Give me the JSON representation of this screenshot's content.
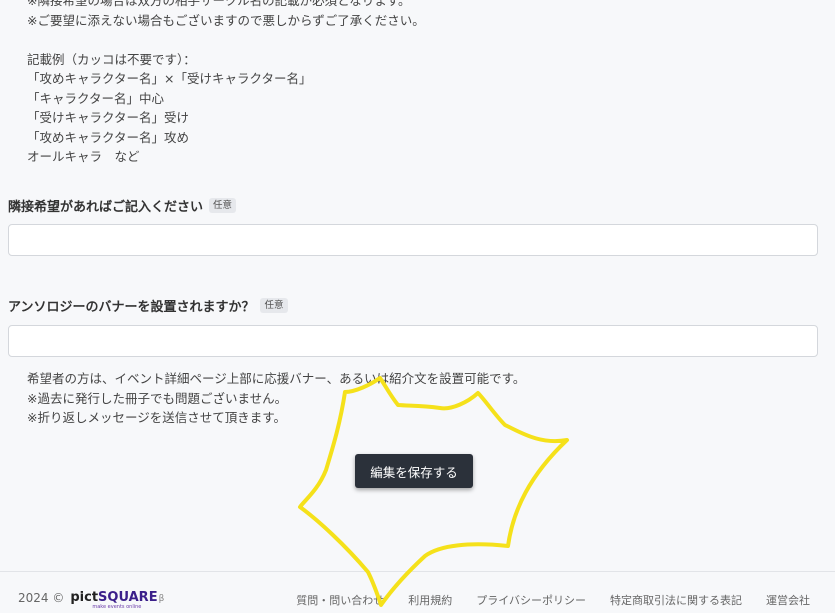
{
  "top_notes": [
    "※隣接希望の場合は双方の相手サークル名の記載が必須となります。",
    "※ご要望に添えない場合もございますので悪しからずご了承ください。",
    "",
    "記載例（カッコは不要です）：",
    "「攻めキャラクター名」×「受けキャラクター名」",
    "「キャラクター名」中心",
    "「受けキャラクター名」受け",
    "「攻めキャラクター名」攻め",
    "オールキャラ　など"
  ],
  "neighbor_field": {
    "label": "隣接希望があればご記入ください",
    "badge": "任意",
    "value": ""
  },
  "anthology_field": {
    "label": "アンソロジーのバナーを設置されますか？",
    "badge": "任意",
    "value": ""
  },
  "anthology_notes": [
    "希望者の方は、イベント詳細ページ上部に応援バナー、あるいは紹介文を設置可能です。",
    "※過去に発行した冊子でも問題ございません。",
    "※折り返しメッセージを送信させて頂きます。"
  ],
  "save_button": {
    "label": "編集を保存する"
  },
  "footer": {
    "year": "2024 ©",
    "logo": {
      "pict": "pict",
      "square": "SQUARE",
      "beta": "β",
      "tagline": "make events online"
    },
    "links": [
      "質問・問い合わせ",
      "利用規約",
      "プライバシーポリシー",
      "特定商取引法に関する表記",
      "運営会社"
    ]
  },
  "colors": {
    "background": "#f7f8fa",
    "button": "#2b313a",
    "scribble": "#f5e11a",
    "logo_accent": "#3b1f8a"
  }
}
